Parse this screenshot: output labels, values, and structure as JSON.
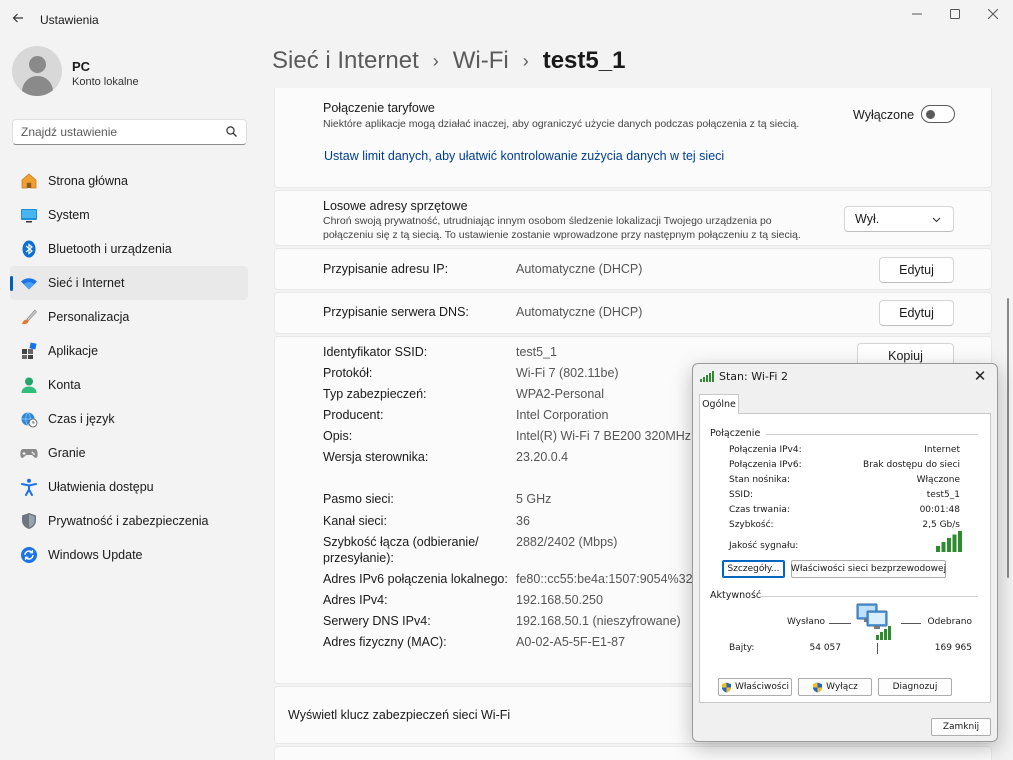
{
  "window": {
    "title": "Ustawienia"
  },
  "profile": {
    "name": "PC",
    "subtitle": "Konto lokalne"
  },
  "search": {
    "placeholder": "Znajdź ustawienie"
  },
  "sidebar": {
    "items": [
      {
        "label": "Strona główna",
        "icon": "home-icon"
      },
      {
        "label": "System",
        "icon": "system-icon"
      },
      {
        "label": "Bluetooth i urządzenia",
        "icon": "bluetooth-icon"
      },
      {
        "label": "Sieć i Internet",
        "icon": "wifi-icon",
        "active": true
      },
      {
        "label": "Personalizacja",
        "icon": "brush-icon"
      },
      {
        "label": "Aplikacje",
        "icon": "apps-icon"
      },
      {
        "label": "Konta",
        "icon": "account-icon"
      },
      {
        "label": "Czas i język",
        "icon": "globe-clock-icon"
      },
      {
        "label": "Granie",
        "icon": "gamepad-icon"
      },
      {
        "label": "Ułatwienia dostępu",
        "icon": "accessibility-icon"
      },
      {
        "label": "Prywatność i zabezpieczenia",
        "icon": "shield-icon"
      },
      {
        "label": "Windows Update",
        "icon": "update-icon"
      }
    ]
  },
  "breadcrumb": {
    "level1": "Sieć i Internet",
    "level2": "Wi-Fi",
    "current": "test5_1"
  },
  "metered": {
    "title": "Połączenie taryfowe",
    "description": "Niektóre aplikacje mogą działać inaczej, aby ograniczyć użycie danych podczas połączenia z tą siecią.",
    "state": "Wyłączone",
    "link": "Ustaw limit danych, aby ułatwić kontrolowanie zużycia danych w tej sieci"
  },
  "random_hw": {
    "title": "Losowe adresy sprzętowe",
    "description": "Chroń swoją prywatność, utrudniając innym osobom śledzenie lokalizacji Twojego urządzenia po połączeniu się z tą siecią. To ustawienie zostanie wprowadzone przy następnym połączeniu z tą siecią.",
    "selected": "Wył."
  },
  "ip_assignment": {
    "label": "Przypisanie adresu IP:",
    "value": "Automatyczne (DHCP)",
    "button": "Edytuj"
  },
  "dns_assignment": {
    "label": "Przypisanie serwera DNS:",
    "value": "Automatyczne (DHCP)",
    "button": "Edytuj"
  },
  "properties": {
    "copy_button": "Kopiuj",
    "rows": [
      {
        "label": "Identyfikator SSID:",
        "value": "test5_1"
      },
      {
        "label": "Protokół:",
        "value": "Wi-Fi 7 (802.11be)"
      },
      {
        "label": "Typ zabezpieczeń:",
        "value": "WPA2-Personal"
      },
      {
        "label": "Producent:",
        "value": "Intel Corporation"
      },
      {
        "label": "Opis:",
        "value": "Intel(R) Wi-Fi 7 BE200 320MHz"
      },
      {
        "label": "Wersja sterownika:",
        "value": "23.20.0.4"
      }
    ],
    "rows2": [
      {
        "label": "Pasmo sieci:",
        "value": "5 GHz"
      },
      {
        "label": "Kanał sieci:",
        "value": "36"
      },
      {
        "label": "Szybkość łącza (odbieranie/",
        "label2": "przesyłanie):",
        "value": "2882/2402 (Mbps)"
      },
      {
        "label": "Adres IPv6 połączenia lokalnego:",
        "value": "fe80::cc55:be4a:1507:9054%32"
      },
      {
        "label": "Adres IPv4:",
        "value": "192.168.50.250"
      },
      {
        "label": "Serwery DNS IPv4:",
        "value": "192.168.50.1 (nieszyfrowane)"
      },
      {
        "label": "Adres fizyczny (MAC):",
        "value": "A0-02-A5-5F-E1-87"
      }
    ]
  },
  "wifi_key": {
    "label": "Wyświetl klucz zabezpieczeń sieci Wi-Fi"
  },
  "dialog": {
    "title": "Stan: Wi-Fi 2",
    "tab": "Ogólne",
    "connection_group": "Połączenie",
    "rows": [
      {
        "label": "Połączenia IPv4:",
        "value": "Internet"
      },
      {
        "label": "Połączenia IPv6:",
        "value": "Brak dostępu do sieci"
      },
      {
        "label": "Stan nośnika:",
        "value": "Włączone"
      },
      {
        "label": "SSID:",
        "value": "test5_1"
      },
      {
        "label": "Czas trwania:",
        "value": "00:01:48"
      },
      {
        "label": "Szybkość:",
        "value": "2,5 Gb/s"
      }
    ],
    "signal_label": "Jakość sygnału:",
    "signal_bars": 5,
    "details_button": "Szczegóły...",
    "wireless_props_button": "Właściwości sieci bezprzewodowej",
    "activity_group": "Aktywność",
    "sent_label": "Wysłano",
    "received_label": "Odebrano",
    "bytes_label": "Bajty:",
    "bytes_sent": "54 057",
    "bytes_received": "169 965",
    "properties_button": "Właściwości",
    "disable_button": "Wyłącz",
    "diagnose_button": "Diagnozuj",
    "close_button": "Zamknij"
  },
  "colors": {
    "accent": "#005fb8",
    "link": "#003e92",
    "signal": "#2e8b2e"
  }
}
